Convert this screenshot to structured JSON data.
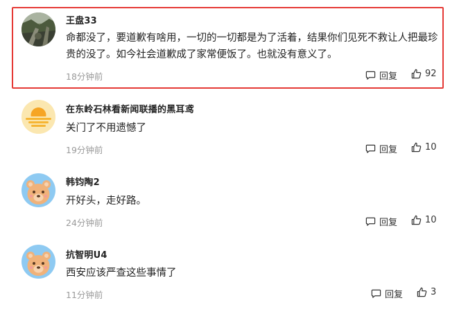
{
  "comments": [
    {
      "username": "王盘33",
      "content": "命都没了，要道歉有啥用，一切的一切都是为了活着，结果你们见死不救让人把最珍贵的没了。如今社会道歉成了家常便饭了。也就没有意义了。",
      "time": "18分钟前",
      "reply_label": "回复",
      "likes": "92",
      "avatar": "photo-avatar",
      "highlighted": true
    },
    {
      "username": "在东岭石林看新闻联播的黑耳鸢",
      "content": "关门了不用遗憾了",
      "time": "19分钟前",
      "reply_label": "回复",
      "likes": "10",
      "avatar": "sunset-avatar"
    },
    {
      "username": "韩钧陶2",
      "content": "开好头，走好路。",
      "time": "24分钟前",
      "reply_label": "回复",
      "likes": "10",
      "avatar": "bear-avatar"
    },
    {
      "username": "抗智明U4",
      "content": "西安应该严查这些事情了",
      "time": "11分钟前",
      "reply_label": "回复",
      "likes": "3",
      "avatar": "bear-avatar"
    }
  ],
  "icons": {
    "reply": "comment-bubble-icon",
    "like": "thumbs-up-icon"
  },
  "colors": {
    "highlight_border": "#e53935",
    "muted_text": "#9a9a9a",
    "bear_background": "#8ecaf2"
  }
}
